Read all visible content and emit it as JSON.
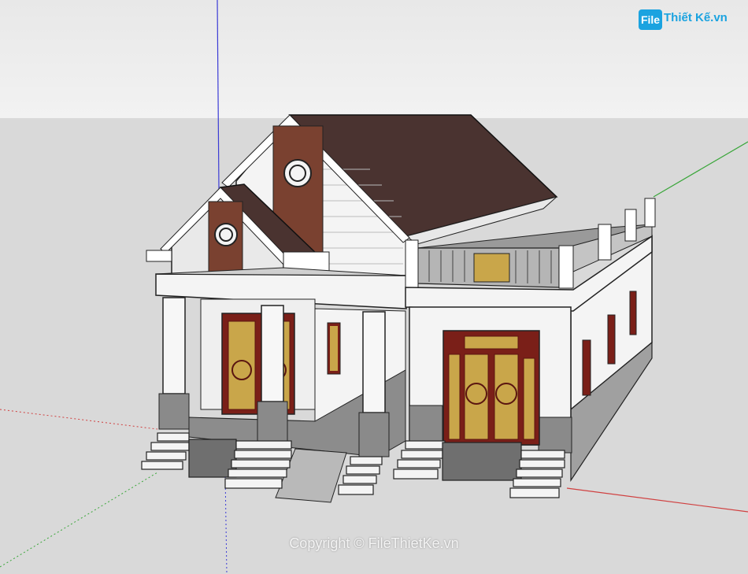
{
  "logo": {
    "badge": "File",
    "name": "Thiết Kế.vn"
  },
  "watermark": "Copyright © FileThietKe.vn",
  "icons": [
    "axis-red",
    "axis-green",
    "axis-blue"
  ],
  "colors": {
    "sky": "#ececec",
    "ground": "#d9d9d9",
    "roof": "#4a3330",
    "brick": "#7a4130",
    "wall": "#f3f3f3",
    "door": "#7a1f18",
    "glass": "#c9a64a",
    "stone": "#8c8c8c",
    "axis_red": "#d04040",
    "axis_green": "#3aa63a",
    "axis_blue": "#3b3bd6",
    "logo": "#1ba3e0"
  }
}
